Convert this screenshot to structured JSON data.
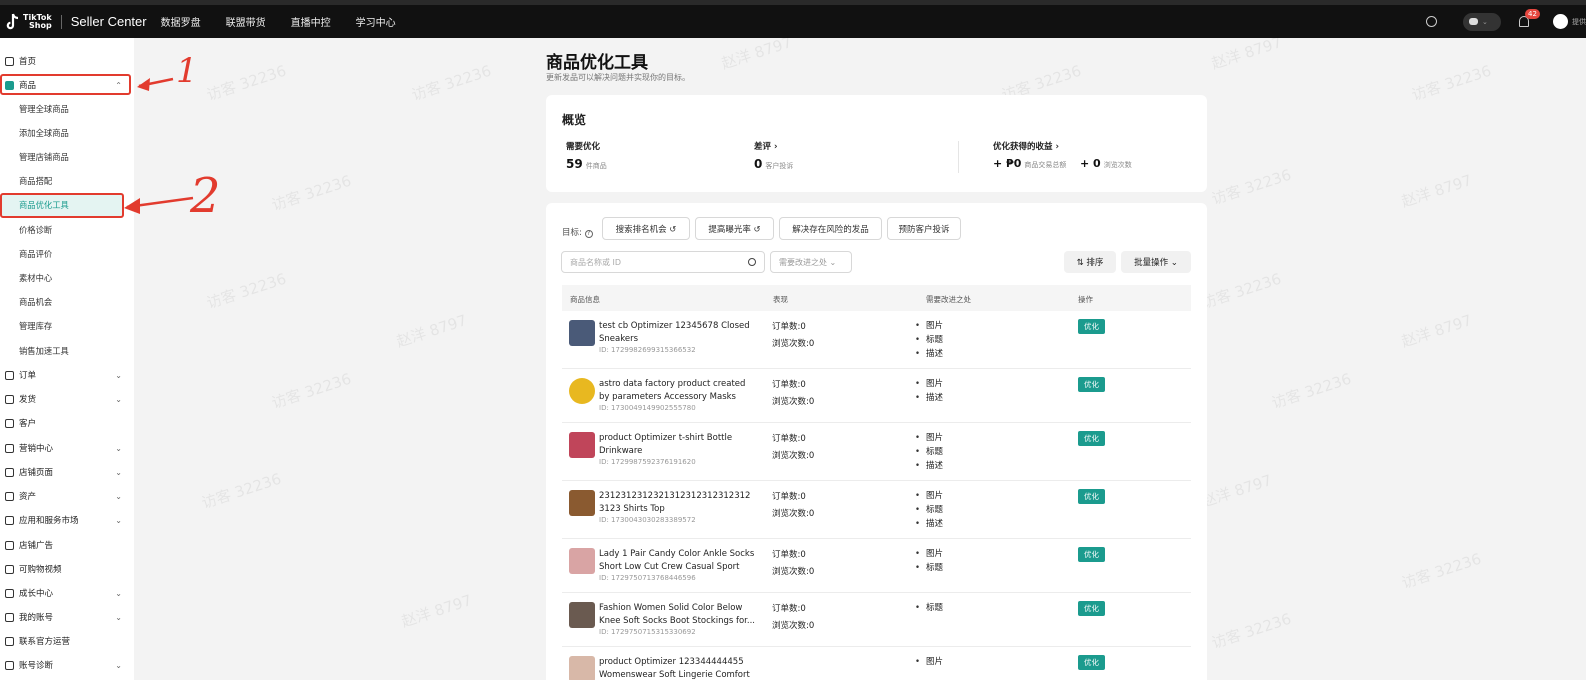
{
  "topbar": {
    "logo_text_1": "TikTok",
    "logo_text_2": "Shop",
    "brand": "Seller Center",
    "nav": [
      "数据罗盘",
      "联盟带货",
      "直播中控",
      "学习中心"
    ],
    "badge_count": "42",
    "user_label": "提供"
  },
  "sidebar": {
    "home": "首页",
    "products": "商品",
    "sub_items": [
      "管理全球商品",
      "添加全球商品",
      "管理店铺商品",
      "商品搭配",
      "商品优化工具",
      "价格诊断",
      "商品评价",
      "素材中心",
      "商品机会",
      "管理库存",
      "销售加速工具"
    ],
    "sections": [
      "订单",
      "发货",
      "客户",
      "营销中心",
      "店铺页面",
      "资产",
      "应用和服务市场",
      "店铺广告",
      "可购物视频",
      "成长中心",
      "我的账号",
      "联系官方运营",
      "账号诊断"
    ]
  },
  "annotations": {
    "mark_1": "1",
    "mark_2": "2"
  },
  "page": {
    "title": "商品优化工具",
    "subtitle": "更新发品可以解决问题并实现你的目标。"
  },
  "overview": {
    "title": "概览",
    "needs_opt_label": "需要优化",
    "needs_opt_value": "59",
    "needs_opt_unit": "件商品",
    "bad_review_label": "差评 ›",
    "bad_review_value": "0",
    "bad_review_unit": "客户投诉",
    "gain_label": "优化获得的收益 ›",
    "gmv_value": "+ ₱0",
    "gmv_unit": "商品交易总额",
    "views_value": "+ 0",
    "views_unit": "浏览次数"
  },
  "filters": {
    "label": "目标:",
    "buttons": [
      "搜索排名机会 ↺",
      "提高曝光率 ↺",
      "解决存在风险的发品",
      "预防客户投诉"
    ],
    "search_placeholder": "商品名称或 ID",
    "dropdown": "需要改进之处 ⌄",
    "sort": "⇅ 排序",
    "bulk": "批量操作 ⌄"
  },
  "table": {
    "headers": [
      "商品信息",
      "表现",
      "需要改进之处",
      "操作"
    ],
    "orders_prefix": "订单数:",
    "views_prefix": "浏览次数:",
    "action": "优化",
    "rows": [
      {
        "name": "test cb Optimizer 12345678 Closed Sneakers",
        "id": "ID: 1729982699315366532",
        "orders": "0",
        "views": "0",
        "needs": [
          "图片",
          "标题",
          "描述"
        ],
        "thumb": "#4a5a78"
      },
      {
        "name": "astro data factory product created by parameters Accessory Masks",
        "id": "ID: 1730049149902555780",
        "orders": "0",
        "views": "0",
        "needs": [
          "图片",
          "描述"
        ],
        "thumb": "#e8b820"
      },
      {
        "name": "product Optimizer t-shirt Bottle Drinkware",
        "id": "ID: 1729987592376191620",
        "orders": "0",
        "views": "0",
        "needs": [
          "图片",
          "标题",
          "描述"
        ],
        "thumb": "#c0455a"
      },
      {
        "name": "2312312312321312312312312312 3123 Shirts Top",
        "id": "ID: 1730043030283389572",
        "orders": "0",
        "views": "0",
        "needs": [
          "图片",
          "标题",
          "描述"
        ],
        "thumb": "#8a5a30"
      },
      {
        "name": "Lady 1 Pair Candy Color Ankle Socks Short Low Cut Crew Casual Sport Bo...",
        "id": "ID: 1729750713768446596",
        "orders": "0",
        "views": "0",
        "needs": [
          "图片",
          "标题"
        ],
        "thumb": "#d9a4a4"
      },
      {
        "name": "Fashion Women Solid Color Below Knee Soft Socks Boot Stockings for...",
        "id": "ID: 1729750715315330692",
        "orders": "0",
        "views": "0",
        "needs": [
          "标题"
        ],
        "thumb": "#6a5a50"
      },
      {
        "name": "product Optimizer 123344444455 Womenswear Soft Lingerie Comfort",
        "id": "",
        "orders": "",
        "views": "",
        "needs": [
          "图片"
        ],
        "thumb": "#d8b8a8"
      }
    ]
  },
  "watermarks": [
    "访客 32236",
    "赵洋 8797"
  ],
  "colors": {
    "accent": "#1b9b8e",
    "annotation": "#e23b2e",
    "topbar": "#111111"
  }
}
